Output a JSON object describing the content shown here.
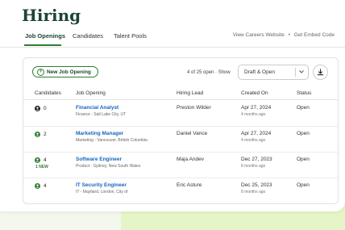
{
  "header": {
    "title": "Hiring"
  },
  "tabs": [
    {
      "label": "Job Openings",
      "active": true
    },
    {
      "label": "Candidates",
      "active": false
    },
    {
      "label": "Talent Pools",
      "active": false
    }
  ],
  "top_links": {
    "careers": "View Careers Website",
    "separator": "•",
    "embed": "Get Embed Code"
  },
  "toolbar": {
    "new_button_label": "New Job Opening",
    "new_button_icon": "plus-circle-icon",
    "count_text": "4 of 25 open · Show",
    "filter_value": "Draft & Open",
    "download_icon": "download-icon"
  },
  "table": {
    "headers": [
      "Candidates",
      "Job Opening",
      "Hiring Lead",
      "Created On",
      "Status"
    ],
    "rows": [
      {
        "candidates": "0",
        "new_badge": "",
        "title": "Financial Analyst",
        "location": "Finance - Salt Lake City, UT",
        "lead": "Preston Wilder",
        "created": "Apr 27, 2024",
        "ago": "4 months ago",
        "status": "Open",
        "icon_color": "#222222"
      },
      {
        "candidates": "2",
        "new_badge": "",
        "title": "Marketing Manager",
        "location": "Marketing - Vancouver, British Columbia",
        "lead": "Daniel Vance",
        "created": "Apr 27, 2024",
        "ago": "4 months ago",
        "status": "Open",
        "icon_color": "#2e7d32"
      },
      {
        "candidates": "4",
        "new_badge": "1 NEW",
        "title": "Software Engineer",
        "location": "Product - Sydney, New South Wales",
        "lead": "Maja Andev",
        "created": "Dec 27, 2023",
        "ago": "8 months ago",
        "status": "Open",
        "icon_color": "#2e7d32"
      },
      {
        "candidates": "4",
        "new_badge": "",
        "title": "IT Security Engineer",
        "location": "IT - Mayfaird, London, City of",
        "lead": "Eric Asture",
        "created": "Dec 25, 2023",
        "ago": "8 months ago",
        "status": "Open",
        "icon_color": "#2e7d32"
      }
    ]
  },
  "colors": {
    "brand": "#1c4532",
    "accent": "#2e7d32",
    "link": "#1565c0",
    "glow": "#e6f5c8"
  }
}
